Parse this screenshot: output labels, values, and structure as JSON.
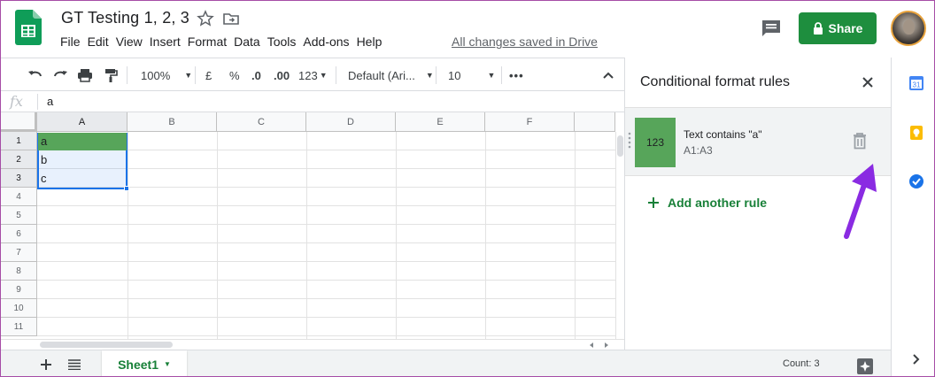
{
  "document": {
    "title": "GT Testing 1, 2, 3",
    "save_status": "All changes saved in Drive"
  },
  "menu": [
    "File",
    "Edit",
    "View",
    "Insert",
    "Format",
    "Data",
    "Tools",
    "Add-ons",
    "Help"
  ],
  "header": {
    "share_label": "Share"
  },
  "toolbar": {
    "zoom": "100%",
    "currency": "£",
    "percent": "%",
    "dec_less": ".0",
    "dec_more": ".00",
    "more_formats": "123",
    "font": "Default (Ari...",
    "font_size": "10"
  },
  "formula_bar": {
    "fx_label": "fx",
    "value": "a"
  },
  "sheet": {
    "columns": [
      "A",
      "B",
      "C",
      "D",
      "E",
      "F"
    ],
    "rows": [
      "1",
      "2",
      "3",
      "4",
      "5",
      "6",
      "7",
      "8",
      "9",
      "10",
      "11"
    ],
    "cells": [
      {
        "ref": "A1",
        "value": "a"
      },
      {
        "ref": "A2",
        "value": "b"
      },
      {
        "ref": "A3",
        "value": "c"
      }
    ],
    "tab_name": "Sheet1",
    "status": "Count: 3"
  },
  "panel": {
    "title": "Conditional format rules",
    "rule": {
      "preview": "123",
      "condition": "Text contains \"a\"",
      "range": "A1:A3",
      "format_color": "#57a55a"
    },
    "add_label": "Add another rule"
  },
  "colors": {
    "brand_green": "#1e8e3e",
    "highlight": "#57a55a",
    "selection": "#1a73e8",
    "annotation_arrow": "#8a2be2"
  }
}
